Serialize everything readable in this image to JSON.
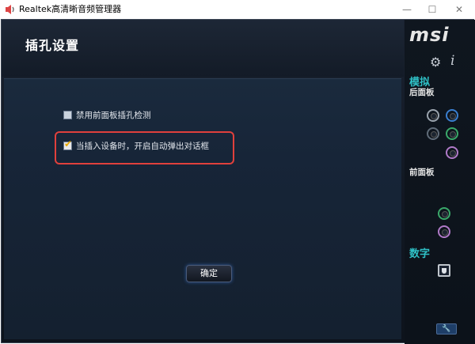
{
  "window": {
    "title": "Realtek高清晰音频管理器",
    "minimize_glyph": "—",
    "maximize_glyph": "☐",
    "close_glyph": "✕"
  },
  "page": {
    "title": "插孔设置"
  },
  "options": [
    {
      "label": "禁用前面板插孔检测",
      "checked": false
    },
    {
      "label": "当插入设备时，开启自动弹出对话框",
      "checked": true
    }
  ],
  "ok_button": {
    "label": "确定"
  },
  "sidebar": {
    "logo": "msi",
    "analog_heading": "模拟",
    "rear_panel_label": "后面板",
    "front_panel_label": "前面板",
    "digital_heading": "数字",
    "rear_jacks": [
      {
        "color": "#9aa3ad",
        "icon": "gray-jack"
      },
      {
        "color": "#3a7fd0",
        "icon": "blue-jack"
      },
      {
        "color": "#5f6b78",
        "icon": "dark-gray-jack"
      },
      {
        "color": "#3aa86a",
        "icon": "green-jack"
      },
      {
        "color": "#b07ac8",
        "icon": "pink-jack"
      }
    ],
    "front_jacks": [
      {
        "color": "#3aa86a",
        "icon": "green-jack"
      },
      {
        "color": "#b07ac8",
        "icon": "pink-jack"
      }
    ]
  },
  "colors": {
    "accent": "#2fc0c6",
    "highlight": "#e0403c",
    "checkmark": "#e8a800"
  }
}
